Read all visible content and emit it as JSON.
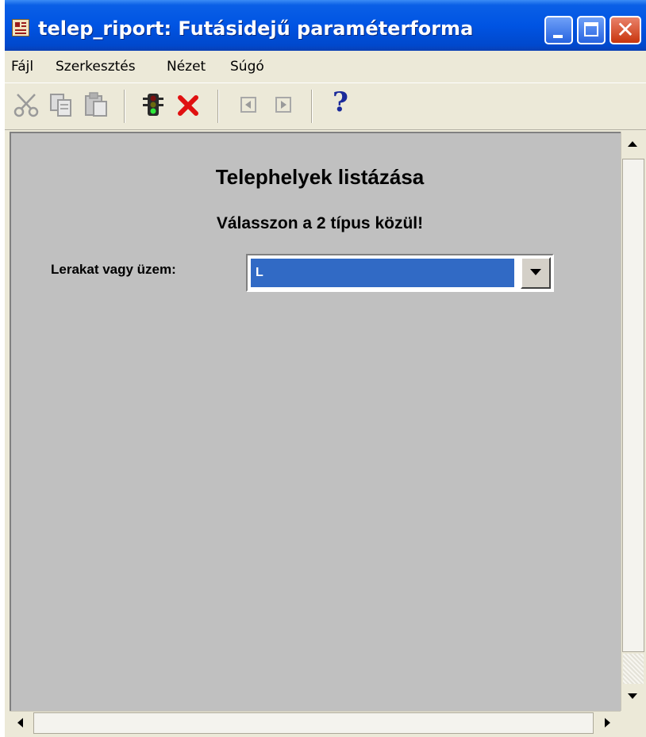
{
  "window": {
    "title": "telep_riport: Futásidejű paraméterforma",
    "icon": "report-app-icon",
    "controls": {
      "minimize": "minimize-icon",
      "maximize": "maximize-icon",
      "close": "close-icon"
    },
    "close_glyph": "✕"
  },
  "menu": {
    "items": [
      "Fájl",
      "Szerkesztés",
      "Nézet",
      "Súgó"
    ]
  },
  "toolbar": {
    "icons": [
      "cut-icon",
      "copy-icon",
      "paste-icon",
      "run-traffic-light-icon",
      "cancel-icon",
      "previous-icon",
      "next-icon",
      "help-icon"
    ],
    "help_glyph": "?"
  },
  "form": {
    "title": "Telephelyek listázása",
    "subtitle": "Válasszon a 2 típus közül!",
    "field_label": "Lerakat vagy üzem:",
    "field_value": "L"
  },
  "colors": {
    "titlebar": "#0054e3",
    "form_background": "#c0c0c0",
    "selection": "#316ac5",
    "cancel_red": "#e01010"
  }
}
